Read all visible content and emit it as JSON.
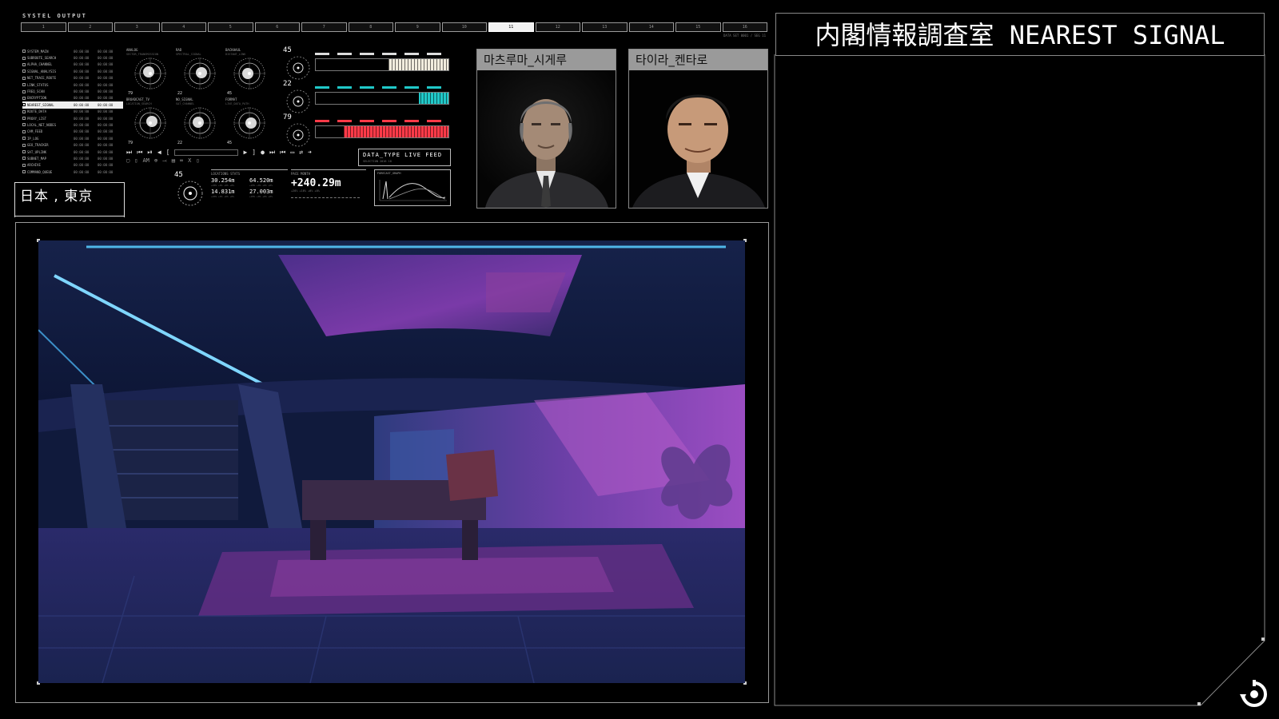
{
  "top_strip": {
    "title": "SYSTEL OUTPUT",
    "segments": [
      "1",
      "2",
      "3",
      "4",
      "5",
      "6",
      "7",
      "8",
      "9",
      "10",
      "11",
      "12",
      "13",
      "14",
      "15",
      "16"
    ],
    "active_segment": 10,
    "meta": "DATA SET 0001 / SEG 11"
  },
  "file_list": {
    "selected_index": 8,
    "rows": [
      {
        "name": "SYSTEM_MAIN",
        "a": "00:00:00",
        "b": "00:00:00"
      },
      {
        "name": "SUBROUTE_SEARCH",
        "a": "00:00:00",
        "b": "00:00:00"
      },
      {
        "name": "ALPHA_CHANNEL",
        "a": "00:00:00",
        "b": "00:00:00"
      },
      {
        "name": "SIGNAL_ANALYSIS",
        "a": "00:00:00",
        "b": "00:00:00"
      },
      {
        "name": "NET_TRACE_ROUTE",
        "a": "00:00:00",
        "b": "00:00:00"
      },
      {
        "name": "LINK_STATUS",
        "a": "00:00:00",
        "b": "00:00:00"
      },
      {
        "name": "FREQ_SCAN",
        "a": "00:00:00",
        "b": "00:00:00"
      },
      {
        "name": "ENCRYPTION",
        "a": "00:00:00",
        "b": "00:00:00"
      },
      {
        "name": "NEAREST_SIGNAL",
        "a": "00:00:00",
        "b": "00:00:00"
      },
      {
        "name": "ROUTE_DATA",
        "a": "00:00:00",
        "b": "00:00:00"
      },
      {
        "name": "PROXY_LIST",
        "a": "00:00:00",
        "b": "00:00:00"
      },
      {
        "name": "LOCAL_NET_NODES",
        "a": "00:00:00",
        "b": "00:00:00"
      },
      {
        "name": "CAM_FEED",
        "a": "00:00:00",
        "b": "00:00:00"
      },
      {
        "name": "IP_LOG",
        "a": "00:00:00",
        "b": "00:00:00"
      },
      {
        "name": "GEO_TRACKER",
        "a": "00:00:00",
        "b": "00:00:00"
      },
      {
        "name": "SAT_UPLINK",
        "a": "00:00:00",
        "b": "00:00:00"
      },
      {
        "name": "SUBNET_MAP",
        "a": "00:00:00",
        "b": "00:00:00"
      },
      {
        "name": "ARCHIVE",
        "a": "00:00:00",
        "b": "00:00:00"
      },
      {
        "name": "COMMAND_QUEUE",
        "a": "00:00:00",
        "b": "00:00:00"
      }
    ]
  },
  "dials": [
    {
      "label": "ANALOG",
      "sub": "SECTOR_TRANSMISSION",
      "num": "79"
    },
    {
      "label": "RAD",
      "sub": "SPECTRAL_SIGNAL",
      "num": "22"
    },
    {
      "label": "BACKHAUL",
      "sub": "DISTANT_LINK",
      "num": "45"
    },
    {
      "label": "BROADCAST_TV",
      "sub": "LOCATION_SEARCH",
      "num": "79"
    },
    {
      "label": "NO_SIGNAL",
      "sub": "SAT_CHANNEL",
      "num": "22"
    },
    {
      "label": "FORMAT",
      "sub": "LIVE_DATA_PATH",
      "num": "45"
    }
  ],
  "meters": [
    {
      "value": "45",
      "fill_color": "#f1ecdd",
      "level": 0.45,
      "top_color": "#dddddd"
    },
    {
      "value": "22",
      "fill_color": "#20c8c8",
      "level": 0.22,
      "top_color": "#20c8c8"
    },
    {
      "value": "79",
      "fill_color": "#ff3a48",
      "level": 0.79,
      "top_color": "#ff3a48"
    }
  ],
  "transport": {
    "row1": [
      "⏭",
      "⏮",
      "⏯",
      "◀",
      "[",
      "▶",
      "]",
      "●",
      "⏭",
      "⏮",
      "▭",
      "⇄",
      "➜"
    ],
    "row2": [
      "▢",
      "▯",
      "AM",
      "⊕",
      "⤙",
      "▤",
      "∞",
      "X",
      "▯"
    ]
  },
  "datatype": {
    "label": "DATA_TYPE LIVE FEED",
    "sub": "SELECTION 2016 18"
  },
  "telemetry": {
    "dial_value": "45",
    "stats_title": "LOCATIONS STATS",
    "stats": [
      {
        "val": "30.254m",
        "sub": "+20% +0% +0% +0%"
      },
      {
        "val": "64.520m",
        "sub": "+20% +0% +0% +0%"
      },
      {
        "val": "14.831m",
        "sub": "+20% +0% +0% +0%"
      },
      {
        "val": "27.003m",
        "sub": "+20% +0% +0% +0%"
      }
    ],
    "pace_title": "PACE MONTH",
    "pace_value": "+240.29m",
    "pace_sub": "+20% +10% +0% +0%",
    "forecast_title": "FORECAST_GRAPH"
  },
  "location": "日本 , 東京",
  "portraits": [
    {
      "label": "마츠루마_시게루"
    },
    {
      "label": "타이라_켄타로"
    }
  ],
  "right_panel": {
    "title": "内閣情報調査室 NEAREST SIGNAL"
  },
  "icons": {
    "reload": "reload-icon"
  }
}
